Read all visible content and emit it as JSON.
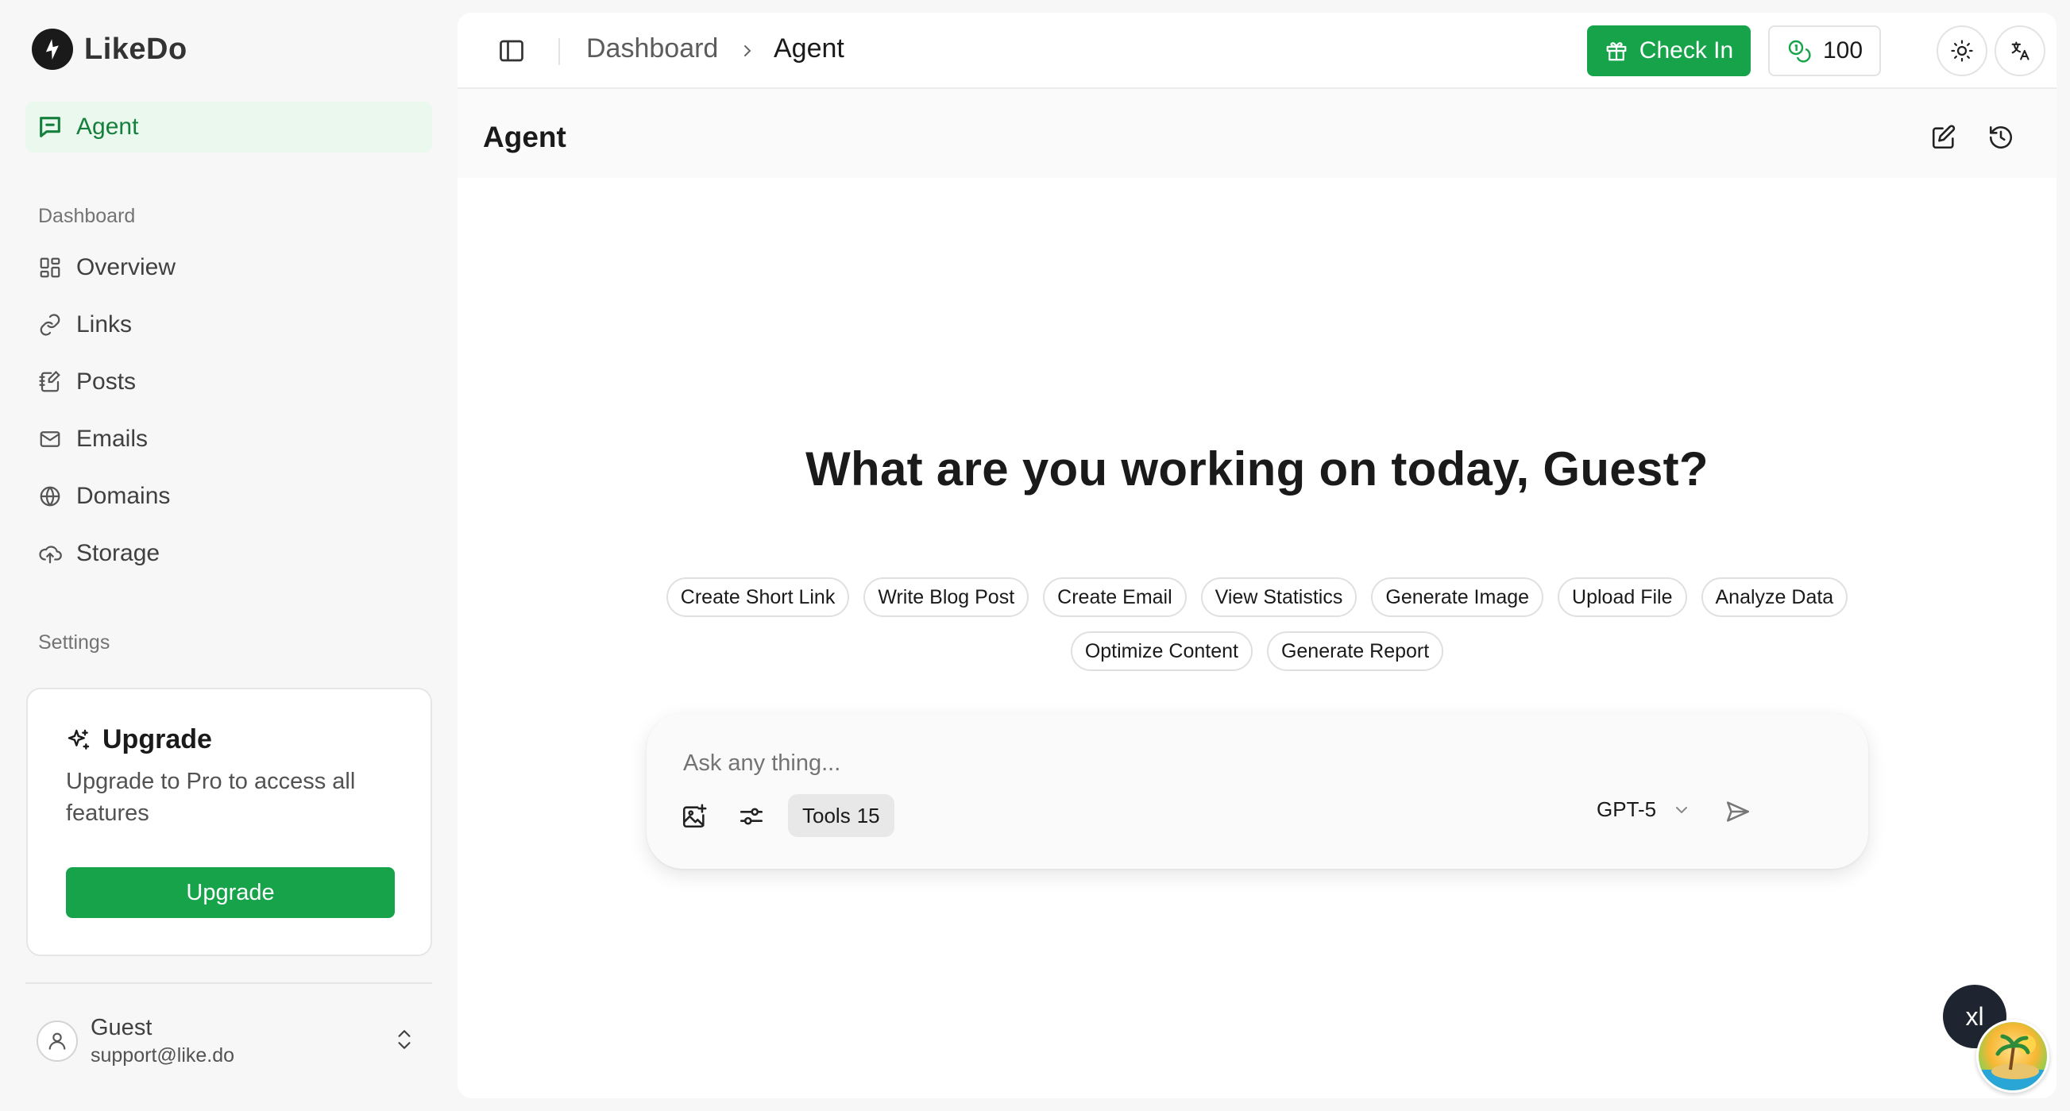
{
  "app": {
    "name": "LikeDo"
  },
  "sidebar": {
    "agent_label": "Agent",
    "dashboard_section": "Dashboard",
    "items": [
      {
        "label": "Overview",
        "icon": "grid-icon"
      },
      {
        "label": "Links",
        "icon": "link-icon"
      },
      {
        "label": "Posts",
        "icon": "posts-icon"
      },
      {
        "label": "Emails",
        "icon": "mail-icon"
      },
      {
        "label": "Domains",
        "icon": "globe-icon"
      },
      {
        "label": "Storage",
        "icon": "cloud-upload-icon"
      }
    ],
    "settings_section": "Settings",
    "upgrade": {
      "title": "Upgrade",
      "description": "Upgrade to Pro to access all features",
      "button": "Upgrade"
    },
    "user": {
      "name": "Guest",
      "email": "support@like.do"
    }
  },
  "header": {
    "breadcrumb": [
      "Dashboard",
      "Agent"
    ],
    "checkin_label": "Check In",
    "credits": "100"
  },
  "page": {
    "title": "Agent",
    "greeting": "What are you working on today, Guest?",
    "suggestions": [
      [
        "Create Short Link",
        "Write Blog Post",
        "Create Email",
        "View Statistics",
        "Generate Image",
        "Upload File",
        "Analyze Data"
      ],
      [
        "Optimize Content",
        "Generate Report"
      ]
    ]
  },
  "composer": {
    "placeholder": "Ask any thing...",
    "tools_label": "Tools",
    "tools_count": "15",
    "model": "GPT-5"
  },
  "floating": {
    "xl_label": "xl"
  },
  "colors": {
    "accent": "#16a34a",
    "accent_bg": "#ebf8ee",
    "accent_text": "#15803d"
  }
}
